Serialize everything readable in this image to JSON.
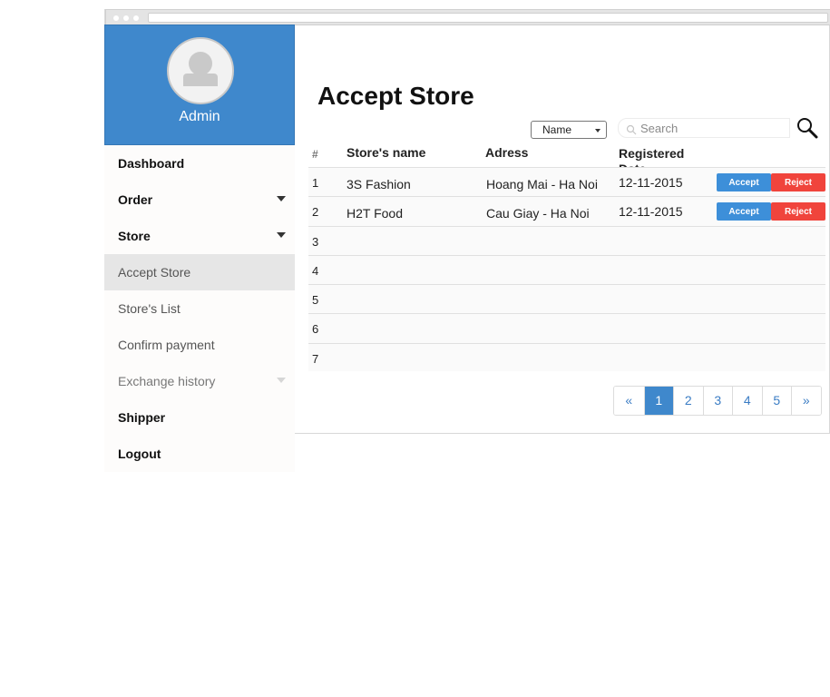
{
  "sidebar": {
    "user_name": "Admin",
    "items": [
      {
        "label": "Dashboard",
        "style": "bold",
        "caret": false
      },
      {
        "label": "Order",
        "style": "bold",
        "caret": true
      },
      {
        "label": "Store",
        "style": "bold",
        "caret": true
      },
      {
        "label": "Accept Store",
        "style": "sub active",
        "caret": false
      },
      {
        "label": "Store's List",
        "style": "sub",
        "caret": false
      },
      {
        "label": "Confirm payment",
        "style": "sub",
        "caret": false
      },
      {
        "label": "Exchange history",
        "style": "sub muted",
        "caret": true
      },
      {
        "label": "Shipper",
        "style": "bold",
        "caret": false
      },
      {
        "label": "Logout",
        "style": "bold",
        "caret": false
      }
    ]
  },
  "main": {
    "title": "Accept Store",
    "filter": {
      "selected": "Name"
    },
    "search": {
      "placeholder": "Search"
    },
    "table": {
      "headers": [
        "#",
        "Store's name",
        "Adress",
        "Registered Date"
      ],
      "rows": [
        {
          "num": "1",
          "name": "3S Fashion",
          "address": "Hoang Mai - Ha Noi",
          "date": "12-11-2015",
          "actions": true
        },
        {
          "num": "2",
          "name": "H2T Food",
          "address": "Cau Giay - Ha Noi",
          "date": "12-11-2015",
          "actions": true
        },
        {
          "num": "3",
          "name": "",
          "address": "",
          "date": "",
          "actions": false
        },
        {
          "num": "4",
          "name": "",
          "address": "",
          "date": "",
          "actions": false
        },
        {
          "num": "5",
          "name": "",
          "address": "",
          "date": "",
          "actions": false
        },
        {
          "num": "6",
          "name": "",
          "address": "",
          "date": "",
          "actions": false
        },
        {
          "num": "7",
          "name": "",
          "address": "",
          "date": "",
          "actions": false
        }
      ],
      "accept_label": "Accept",
      "reject_label": "Reject"
    },
    "pagination": {
      "prev": "«",
      "pages": [
        "1",
        "2",
        "3",
        "4",
        "5"
      ],
      "next": "»",
      "active": "1"
    }
  },
  "colors": {
    "accent": "#3f88cc",
    "accept": "#3d8fd9",
    "reject": "#f0443c"
  }
}
